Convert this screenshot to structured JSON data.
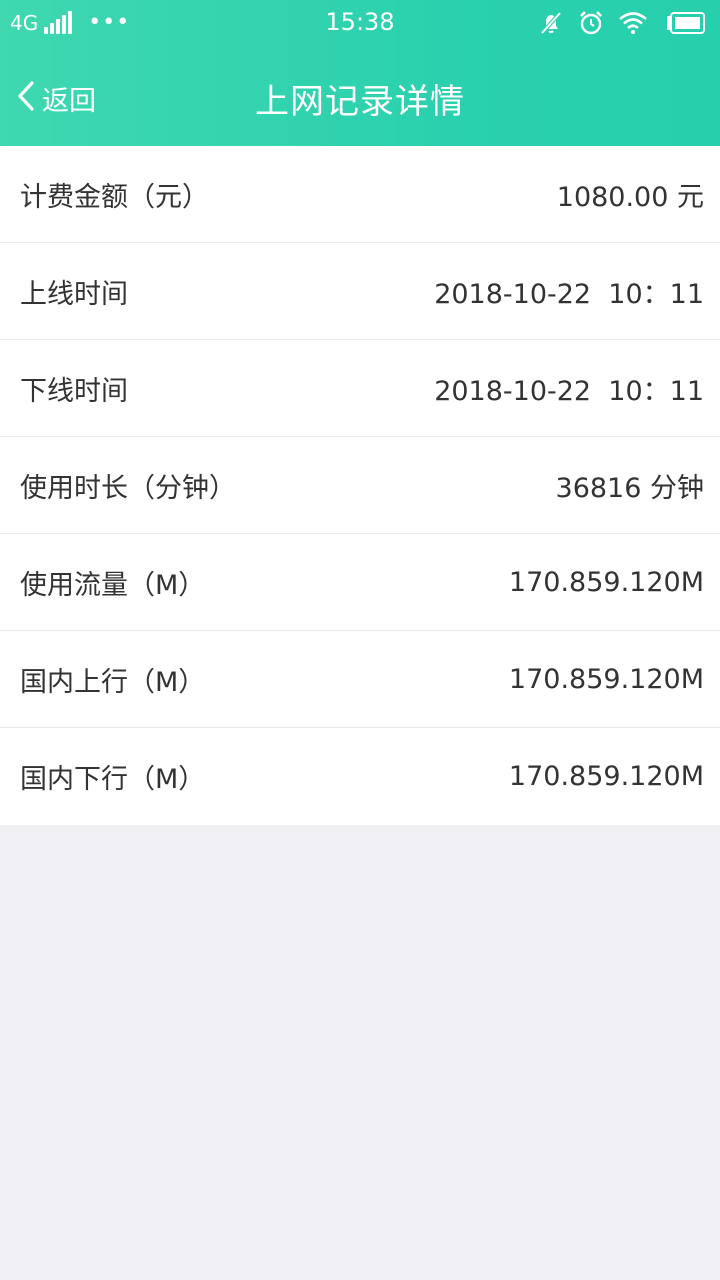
{
  "status_bar": {
    "network": "4G",
    "more": "•••",
    "time": "15:38"
  },
  "nav": {
    "back_label": "返回",
    "title": "上网记录详情"
  },
  "rows": [
    {
      "label": "计费金额（元）",
      "value": "1080.00 元"
    },
    {
      "label": "上线时间",
      "value": "2018-10-22  10：11"
    },
    {
      "label": "下线时间",
      "value": "2018-10-22  10：11"
    },
    {
      "label": "使用时长（分钟）",
      "value": "36816 分钟"
    },
    {
      "label": "使用流量（M）",
      "value": "170.859.120M"
    },
    {
      "label": "国内上行（M）",
      "value": "170.859.120M"
    },
    {
      "label": "国内下行（M）",
      "value": "170.859.120M"
    }
  ],
  "colors": {
    "header_start": "#3fd8b0",
    "header_end": "#27cfad",
    "background": "#efeff4"
  }
}
